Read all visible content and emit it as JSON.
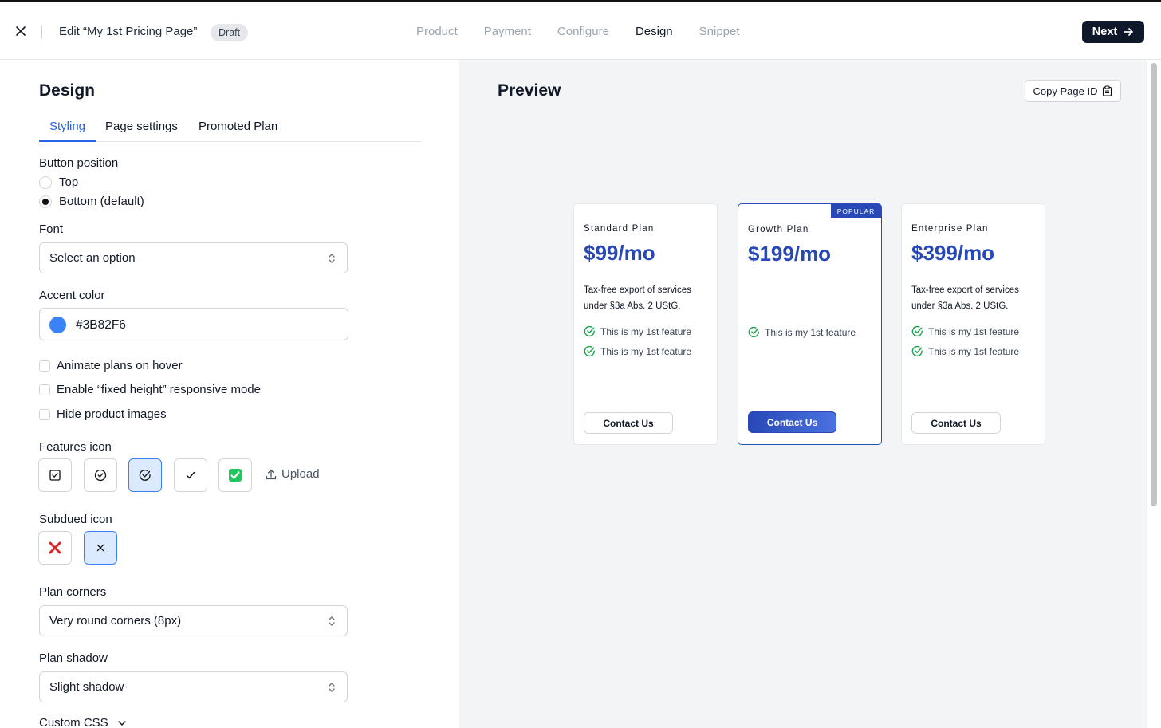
{
  "header": {
    "title": "Edit “My 1st Pricing Page”",
    "badge": "Draft",
    "steps": [
      "Product",
      "Payment",
      "Configure",
      "Design",
      "Snippet"
    ],
    "active_step": "Design",
    "next_label": "Next"
  },
  "design": {
    "heading": "Design",
    "tabs": [
      "Styling",
      "Page settings",
      "Promoted Plan"
    ],
    "active_tab": "Styling",
    "button_position": {
      "label": "Button position",
      "options": [
        "Top",
        "Bottom (default)"
      ],
      "selected": "Bottom (default)"
    },
    "font": {
      "label": "Font",
      "value": "Select an option"
    },
    "accent_color": {
      "label": "Accent color",
      "value": "#3B82F6"
    },
    "checkboxes": [
      "Animate plans on hover",
      "Enable “fixed height” responsive mode",
      "Hide product images"
    ],
    "features_icon": {
      "label": "Features icon",
      "icons": [
        "checkbox-square-icon",
        "check-circle-icon",
        "check-circle-alt-icon",
        "checkmark-icon",
        "green-check-emoji-icon"
      ],
      "selected_index": 2,
      "upload_label": "Upload"
    },
    "subdued_icon": {
      "label": "Subdued icon",
      "icons": [
        "red-x-icon",
        "x-icon"
      ],
      "selected_index": 1
    },
    "plan_corners": {
      "label": "Plan corners",
      "value": "Very round corners (8px)"
    },
    "plan_shadow": {
      "label": "Plan shadow",
      "value": "Slight shadow"
    },
    "custom_css_label": "Custom CSS"
  },
  "preview": {
    "heading": "Preview",
    "copy_label": "Copy Page ID",
    "plans": [
      {
        "name": "Standard Plan",
        "price": "$99/mo",
        "description": "Tax-free export of services under §3a Abs. 2 UStG.",
        "features": [
          "This is my 1st feature",
          "This is my 1st feature"
        ],
        "cta": "Contact Us",
        "promoted": false
      },
      {
        "name": "Growth Plan",
        "price": "$199/mo",
        "description": "",
        "features": [
          "This is my 1st feature"
        ],
        "cta": "Contact Us",
        "promoted": true,
        "badge": "POPULAR"
      },
      {
        "name": "Enterprise Plan",
        "price": "$399/mo",
        "description": "Tax-free export of services under §3a Abs. 2 UStG.",
        "features": [
          "This is my 1st feature",
          "This is my 1st feature"
        ],
        "cta": "Contact Us",
        "promoted": false
      }
    ]
  },
  "colors": {
    "accent": "#3B82F6",
    "plan_blue": "#2748b6",
    "check_green": "#16a34a",
    "next_button": "#0f172a"
  }
}
